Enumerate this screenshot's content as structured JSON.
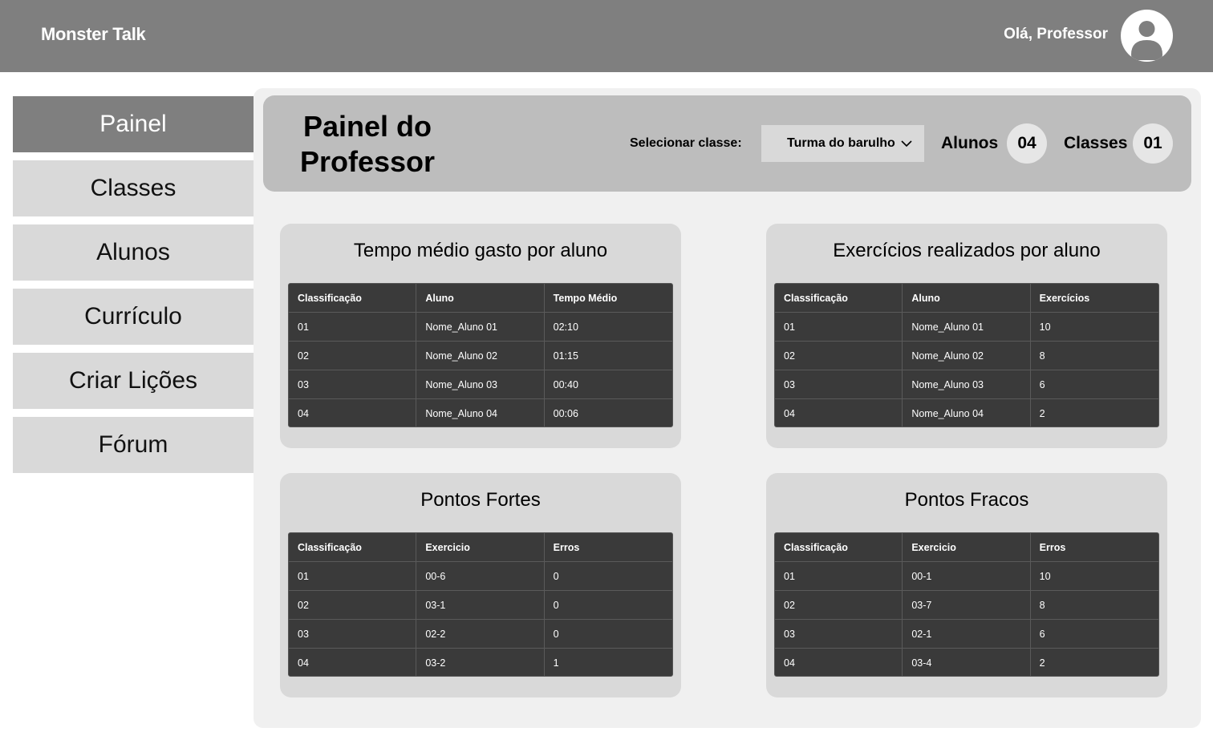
{
  "header": {
    "brand": "Monster Talk",
    "greeting": "Olá, Professor"
  },
  "sidebar": {
    "items": [
      {
        "label": "Painel",
        "active": true
      },
      {
        "label": "Classes",
        "active": false
      },
      {
        "label": "Alunos",
        "active": false
      },
      {
        "label": "Currículo",
        "active": false
      },
      {
        "label": "Criar Lições",
        "active": false
      },
      {
        "label": "Fórum",
        "active": false
      }
    ]
  },
  "page": {
    "title_line1": "Painel do",
    "title_line2": "Professor",
    "select_label": "Selecionar classe:",
    "selected_class": "Turma do barulho",
    "students_label": "Alunos",
    "students_count": "04",
    "classes_label": "Classes",
    "classes_count": "01"
  },
  "cards": {
    "time": {
      "title": "Tempo médio gasto por aluno",
      "columns": [
        "Classificação",
        "Aluno",
        "Tempo Médio"
      ],
      "rows": [
        [
          "01",
          "Nome_Aluno 01",
          "02:10"
        ],
        [
          "02",
          "Nome_Aluno 02",
          "01:15"
        ],
        [
          "03",
          "Nome_Aluno 03",
          "00:40"
        ],
        [
          "04",
          "Nome_Aluno 04",
          "00:06"
        ]
      ]
    },
    "exercises": {
      "title": "Exercícios realizados por aluno",
      "columns": [
        "Classificação",
        "Aluno",
        "Exercícios"
      ],
      "rows": [
        [
          "01",
          "Nome_Aluno 01",
          "10"
        ],
        [
          "02",
          "Nome_Aluno 02",
          "8"
        ],
        [
          "03",
          "Nome_Aluno 03",
          "6"
        ],
        [
          "04",
          "Nome_Aluno 04",
          "2"
        ]
      ]
    },
    "strengths": {
      "title": "Pontos Fortes",
      "columns": [
        "Classificação",
        "Exercicio",
        "Erros"
      ],
      "rows": [
        [
          "01",
          "00-6",
          "0"
        ],
        [
          "02",
          "03-1",
          "0"
        ],
        [
          "03",
          "02-2",
          "0"
        ],
        [
          "04",
          "03-2",
          "1"
        ]
      ]
    },
    "weaknesses": {
      "title": "Pontos Fracos",
      "columns": [
        "Classificação",
        "Exercicio",
        "Erros"
      ],
      "rows": [
        [
          "01",
          "00-1",
          "10"
        ],
        [
          "02",
          "03-7",
          "8"
        ],
        [
          "03",
          "02-1",
          "6"
        ],
        [
          "04",
          "03-4",
          "2"
        ]
      ]
    }
  },
  "colors": {
    "header_bg": "#7f7f7f",
    "sidebar_item": "#d9d9d9",
    "sidebar_active": "#7f7f7f",
    "table_bg": "#3a3a3a",
    "card_bg": "#d9d9d9"
  },
  "icons": [
    "user-avatar-icon",
    "chevron-down-icon"
  ]
}
